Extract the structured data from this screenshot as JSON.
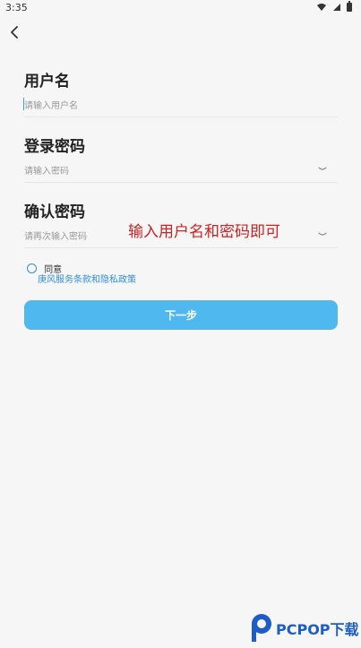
{
  "status_bar": {
    "time": "3:35",
    "icons": [
      "wifi-icon",
      "signal-icon",
      "battery-icon"
    ]
  },
  "nav": {
    "back_icon": "chevron-left-icon"
  },
  "form": {
    "username": {
      "title": "用户名",
      "placeholder": "请输入用户名"
    },
    "password": {
      "title": "登录密码",
      "placeholder": "请输入密码",
      "toggle_icon": "eye-closed-icon"
    },
    "confirm_password": {
      "title": "确认密码",
      "placeholder": "请再次输入密码",
      "toggle_icon": "eye-closed-icon"
    },
    "agreement": {
      "label": "同意",
      "link_text": "庚风服务条款和隐私政策",
      "checked": false
    },
    "next_button": {
      "label": "下一步"
    }
  },
  "annotation": {
    "text": "输入用户名和密码即可"
  },
  "watermark": {
    "brand": "PCPOP下载"
  },
  "colors": {
    "accent": "#4fb8ef",
    "link": "#2f8ee6",
    "annotation": "#cc2222",
    "background": "#f6f6f6"
  }
}
